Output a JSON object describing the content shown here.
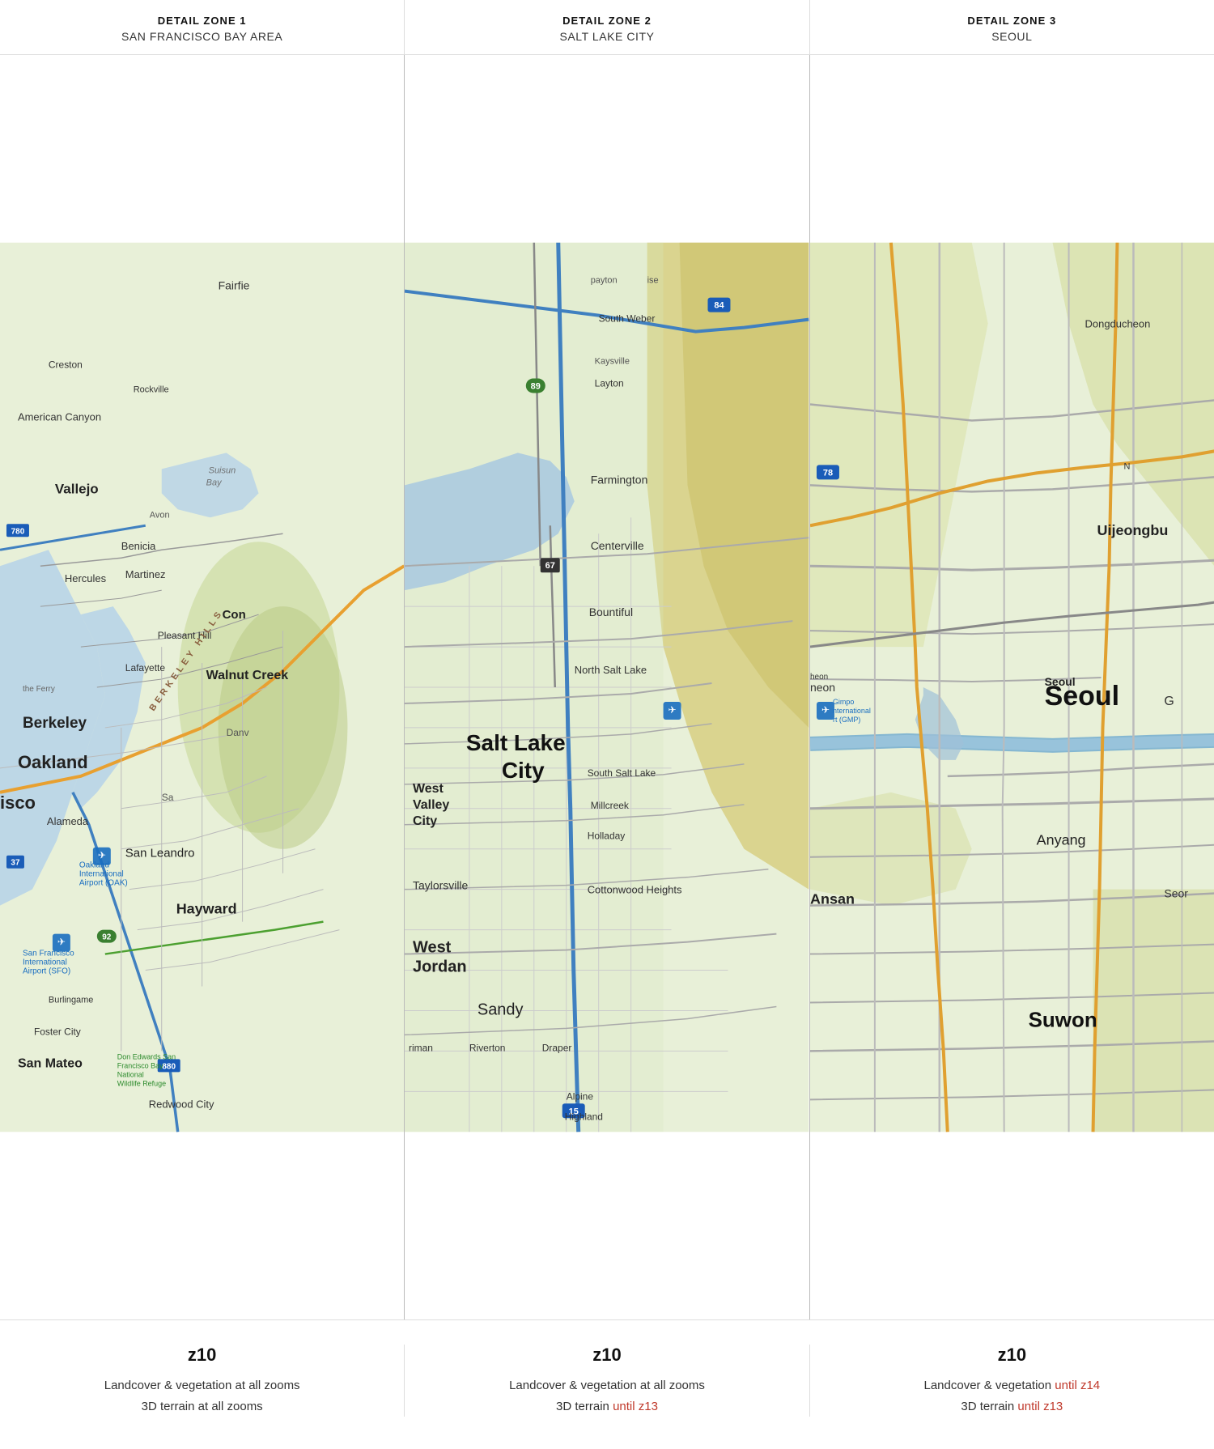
{
  "header": {
    "zones": [
      {
        "label": "DETAIL ZONE 1",
        "city": "SAN FRANCISCO BAY AREA"
      },
      {
        "label": "DETAIL ZONE 2",
        "city": "SALT LAKE CITY"
      },
      {
        "label": "DETAIL ZONE 3",
        "city": "SEOUL"
      }
    ]
  },
  "footer": {
    "zones": [
      {
        "zoom": "z10",
        "line1": "Landcover & vegetation at all zooms",
        "line2": "3D terrain at all zooms",
        "line1_suffix": null,
        "line2_suffix": null
      },
      {
        "zoom": "z10",
        "line1": "Landcover & vegetation at all zooms",
        "line2": "3D terrain ",
        "line1_suffix": null,
        "line2_suffix": "until z13"
      },
      {
        "zoom": "z10",
        "line1": "Landcover & vegetation ",
        "line1_suffix": "until z14",
        "line2": "3D terrain ",
        "line2_suffix": "until z13"
      }
    ]
  }
}
